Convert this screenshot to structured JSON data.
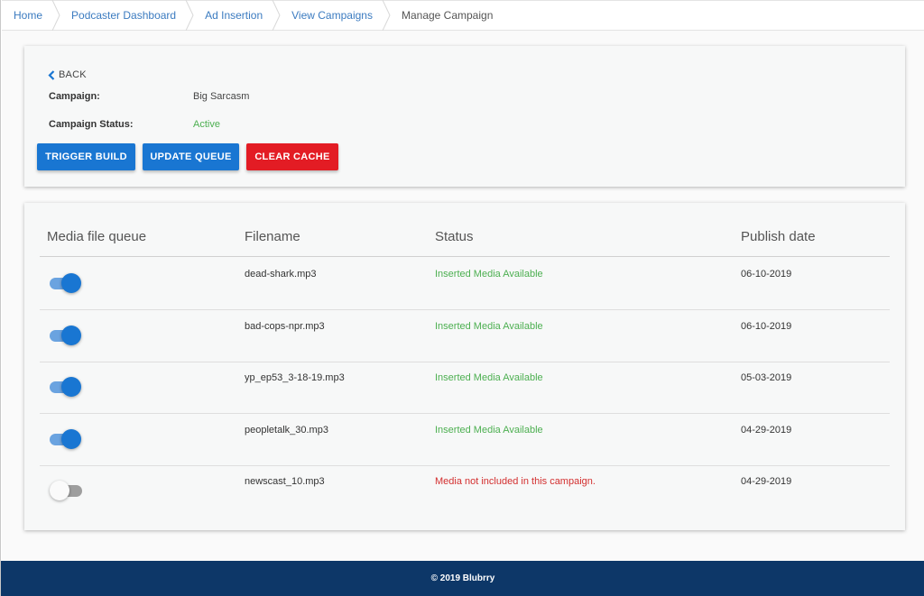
{
  "breadcrumb": {
    "items": [
      "Home",
      "Podcaster Dashboard",
      "Ad Insertion",
      "View Campaigns"
    ],
    "current": "Manage Campaign"
  },
  "campaign": {
    "back_label": "BACK",
    "campaign_label": "Campaign:",
    "campaign_name": "Big Sarcasm",
    "status_label": "Campaign Status:",
    "status_value": "Active",
    "status_color": "#4caf50"
  },
  "actions": {
    "trigger_build": "TRIGGER BUILD",
    "update_queue": "UPDATE QUEUE",
    "clear_cache": "CLEAR CACHE"
  },
  "table": {
    "headers": {
      "queue": "Media file queue",
      "filename": "Filename",
      "status": "Status",
      "publish_date": "Publish date"
    },
    "rows": [
      {
        "enabled": true,
        "filename": "dead-shark.mp3",
        "status": "Inserted Media Available",
        "publish_date": "06-10-2019"
      },
      {
        "enabled": true,
        "filename": "bad-cops-npr.mp3",
        "status": "Inserted Media Available",
        "publish_date": "06-10-2019"
      },
      {
        "enabled": true,
        "filename": "yp_ep53_3-18-19.mp3",
        "status": "Inserted Media Available",
        "publish_date": "05-03-2019"
      },
      {
        "enabled": true,
        "filename": "peopletalk_30.mp3",
        "status": "Inserted Media Available",
        "publish_date": "04-29-2019"
      },
      {
        "enabled": false,
        "filename": "newscast_10.mp3",
        "status": "Media not included in this campaign.",
        "publish_date": "04-29-2019"
      }
    ]
  },
  "footer": {
    "text": "© 2019 Blubrry"
  },
  "colors": {
    "primary": "#1976d2",
    "danger": "#e31c24",
    "success": "#4caf50",
    "error": "#d32f2f",
    "footer_bg": "#0d3768",
    "link": "#3b7bc0"
  },
  "icons": {
    "back": "chevron-left-icon"
  }
}
